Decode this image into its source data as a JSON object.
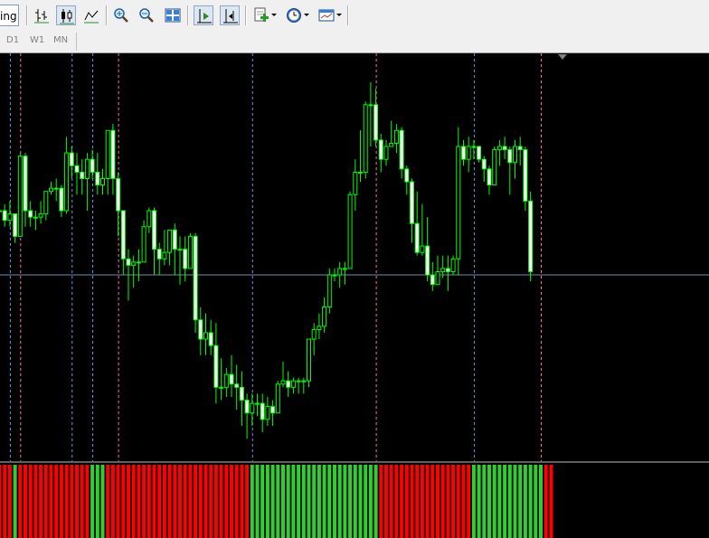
{
  "toolbar": {
    "stub_text": "ing",
    "buttons": [
      "bar-chart-icon",
      "candlestick-icon",
      "line-chart-icon",
      "zoom-in-icon",
      "zoom-out-icon",
      "tile-windows-icon",
      "chart-shift-icon",
      "autoscroll-icon",
      "indicators-icon",
      "periods-icon",
      "templates-icon"
    ]
  },
  "timeframes": [
    "D1",
    "W1",
    "MN"
  ],
  "colors": {
    "background": "#000000",
    "candle_body_bull": "#000000",
    "candle_body_bear": "#ffffff",
    "candle_outline": "#00ff00",
    "period_sep_blue": "#6495ed",
    "period_sep_pink": "#ff69b4",
    "price_line": "#6e8bb0",
    "histogram_up": "#32cd32",
    "histogram_down": "#ff0000"
  },
  "chart_data": {
    "type": "candlestick",
    "ohlc": [
      [
        50,
        50,
        52,
        48
      ],
      [
        50,
        47,
        52,
        45
      ],
      [
        47,
        49,
        53,
        45
      ],
      [
        49,
        42,
        49,
        40
      ],
      [
        42,
        67,
        68,
        42
      ],
      [
        67,
        50,
        68,
        45
      ],
      [
        50,
        48,
        53,
        45
      ],
      [
        48,
        48,
        50,
        44
      ],
      [
        48,
        49,
        53,
        46
      ],
      [
        49,
        56,
        56,
        47
      ],
      [
        56,
        57,
        59,
        55
      ],
      [
        57,
        57,
        60,
        53
      ],
      [
        57,
        50,
        58,
        48
      ],
      [
        50,
        68,
        73,
        49
      ],
      [
        68,
        64,
        70,
        60
      ],
      [
        64,
        62,
        68,
        55
      ],
      [
        62,
        60,
        66,
        55
      ],
      [
        60,
        66,
        68,
        50
      ],
      [
        66,
        62,
        69,
        60
      ],
      [
        62,
        58,
        68,
        55
      ],
      [
        58,
        60,
        63,
        55
      ],
      [
        60,
        75,
        75,
        55
      ],
      [
        75,
        60,
        77,
        55
      ],
      [
        60,
        50,
        62,
        42
      ],
      [
        50,
        35,
        50,
        30
      ],
      [
        35,
        33,
        38,
        22
      ],
      [
        33,
        34,
        36,
        26
      ],
      [
        34,
        34,
        38,
        28
      ],
      [
        34,
        45,
        47,
        34
      ],
      [
        45,
        50,
        51,
        43
      ],
      [
        50,
        38,
        51,
        30
      ],
      [
        38,
        35,
        40,
        30
      ],
      [
        35,
        37,
        44,
        33
      ],
      [
        37,
        44,
        44,
        33
      ],
      [
        44,
        38,
        46,
        30
      ],
      [
        38,
        38,
        42,
        27
      ],
      [
        38,
        32,
        42,
        28
      ],
      [
        32,
        42,
        43,
        32
      ],
      [
        42,
        16,
        43,
        12
      ],
      [
        16,
        10,
        20,
        5
      ],
      [
        10,
        12,
        18,
        5
      ],
      [
        12,
        8,
        16,
        5
      ],
      [
        8,
        -5,
        15,
        -10
      ],
      [
        -5,
        -5,
        4,
        -9
      ],
      [
        -5,
        -1,
        1,
        -8
      ],
      [
        -1,
        -4,
        5,
        -8
      ],
      [
        -4,
        -5,
        2,
        -12
      ],
      [
        -5,
        -9,
        0,
        -17
      ],
      [
        -9,
        -13,
        -7,
        -21
      ],
      [
        -13,
        -10,
        -7,
        -17
      ],
      [
        -10,
        -10,
        -7,
        -14
      ],
      [
        -10,
        -15,
        -7,
        -19
      ],
      [
        -15,
        -11,
        -8,
        -17
      ],
      [
        -11,
        -13,
        -9,
        -17
      ],
      [
        -13,
        -4,
        -3,
        -10
      ],
      [
        -4,
        -3,
        3,
        -5
      ],
      [
        -3,
        -5,
        0,
        -8
      ],
      [
        -5,
        -3,
        -2,
        -7
      ],
      [
        -3,
        -3,
        -2,
        -7
      ],
      [
        -3,
        -3,
        -2,
        -7
      ],
      [
        -3,
        10,
        10,
        -5
      ],
      [
        10,
        13,
        15,
        5
      ],
      [
        13,
        14,
        18,
        10
      ],
      [
        14,
        20,
        23,
        12
      ],
      [
        20,
        30,
        32,
        18
      ],
      [
        30,
        30,
        32,
        28
      ],
      [
        30,
        32,
        34,
        26
      ],
      [
        32,
        32,
        34,
        27
      ],
      [
        32,
        55,
        56,
        32
      ],
      [
        55,
        62,
        66,
        50
      ],
      [
        62,
        62,
        75,
        59
      ],
      [
        62,
        83,
        84,
        60
      ],
      [
        83,
        83,
        90,
        70
      ],
      [
        83,
        72,
        88,
        70
      ],
      [
        72,
        66,
        74,
        62
      ],
      [
        66,
        70,
        72,
        64
      ],
      [
        70,
        71,
        78,
        70
      ],
      [
        71,
        75,
        77,
        68
      ],
      [
        75,
        63,
        76,
        60
      ],
      [
        63,
        59,
        64,
        55
      ],
      [
        59,
        46,
        60,
        40
      ],
      [
        46,
        37,
        56,
        36
      ],
      [
        37,
        39,
        52,
        36
      ],
      [
        39,
        30,
        48,
        28
      ],
      [
        30,
        27,
        34,
        25
      ],
      [
        27,
        31,
        36,
        30
      ],
      [
        31,
        32,
        36,
        29
      ],
      [
        32,
        31,
        36,
        25
      ],
      [
        31,
        35,
        36,
        30
      ],
      [
        35,
        70,
        76,
        30
      ],
      [
        70,
        66,
        72,
        64
      ],
      [
        66,
        70,
        73,
        62
      ],
      [
        70,
        70,
        72,
        66
      ],
      [
        70,
        66,
        70,
        65
      ],
      [
        66,
        63,
        67,
        59
      ],
      [
        63,
        58,
        64,
        55
      ],
      [
        58,
        69,
        70,
        58
      ],
      [
        69,
        70,
        72,
        64
      ],
      [
        70,
        69,
        73,
        66
      ],
      [
        69,
        65,
        70,
        55
      ],
      [
        65,
        70,
        72,
        60
      ],
      [
        70,
        69,
        73,
        64
      ],
      [
        69,
        53,
        70,
        50
      ],
      [
        53,
        31,
        56,
        28
      ]
    ],
    "price_line": 30,
    "ylim": [
      -28,
      99
    ],
    "period_separators": [
      {
        "index": 2,
        "color": "blue"
      },
      {
        "index": 4,
        "color": "pink"
      },
      {
        "index": 14,
        "color": "blue"
      },
      {
        "index": 18,
        "color": "blue"
      },
      {
        "index": 23,
        "color": "pink"
      },
      {
        "index": 49,
        "color": "blue"
      },
      {
        "index": 73,
        "color": "pink"
      },
      {
        "index": 92,
        "color": "blue"
      },
      {
        "index": 105,
        "color": "pink"
      }
    ],
    "histogram": [
      "down",
      "down",
      "down",
      "up",
      "down",
      "down",
      "down",
      "down",
      "down",
      "down",
      "down",
      "down",
      "down",
      "down",
      "down",
      "down",
      "down",
      "down",
      "up",
      "up",
      "up",
      "down",
      "down",
      "down",
      "down",
      "down",
      "down",
      "down",
      "down",
      "down",
      "down",
      "down",
      "down",
      "down",
      "down",
      "down",
      "down",
      "down",
      "down",
      "down",
      "down",
      "down",
      "down",
      "down",
      "down",
      "down",
      "down",
      "down",
      "down",
      "up",
      "up",
      "up",
      "up",
      "up",
      "up",
      "up",
      "up",
      "up",
      "up",
      "up",
      "up",
      "up",
      "up",
      "up",
      "up",
      "up",
      "up",
      "up",
      "up",
      "up",
      "up",
      "up",
      "up",
      "up",
      "down",
      "down",
      "down",
      "down",
      "down",
      "down",
      "down",
      "down",
      "down",
      "down",
      "down",
      "down",
      "down",
      "down",
      "down",
      "down",
      "down",
      "down",
      "up",
      "up",
      "up",
      "up",
      "up",
      "up",
      "up",
      "up",
      "up",
      "up",
      "up",
      "up",
      "up",
      "up",
      "down",
      "down"
    ]
  }
}
